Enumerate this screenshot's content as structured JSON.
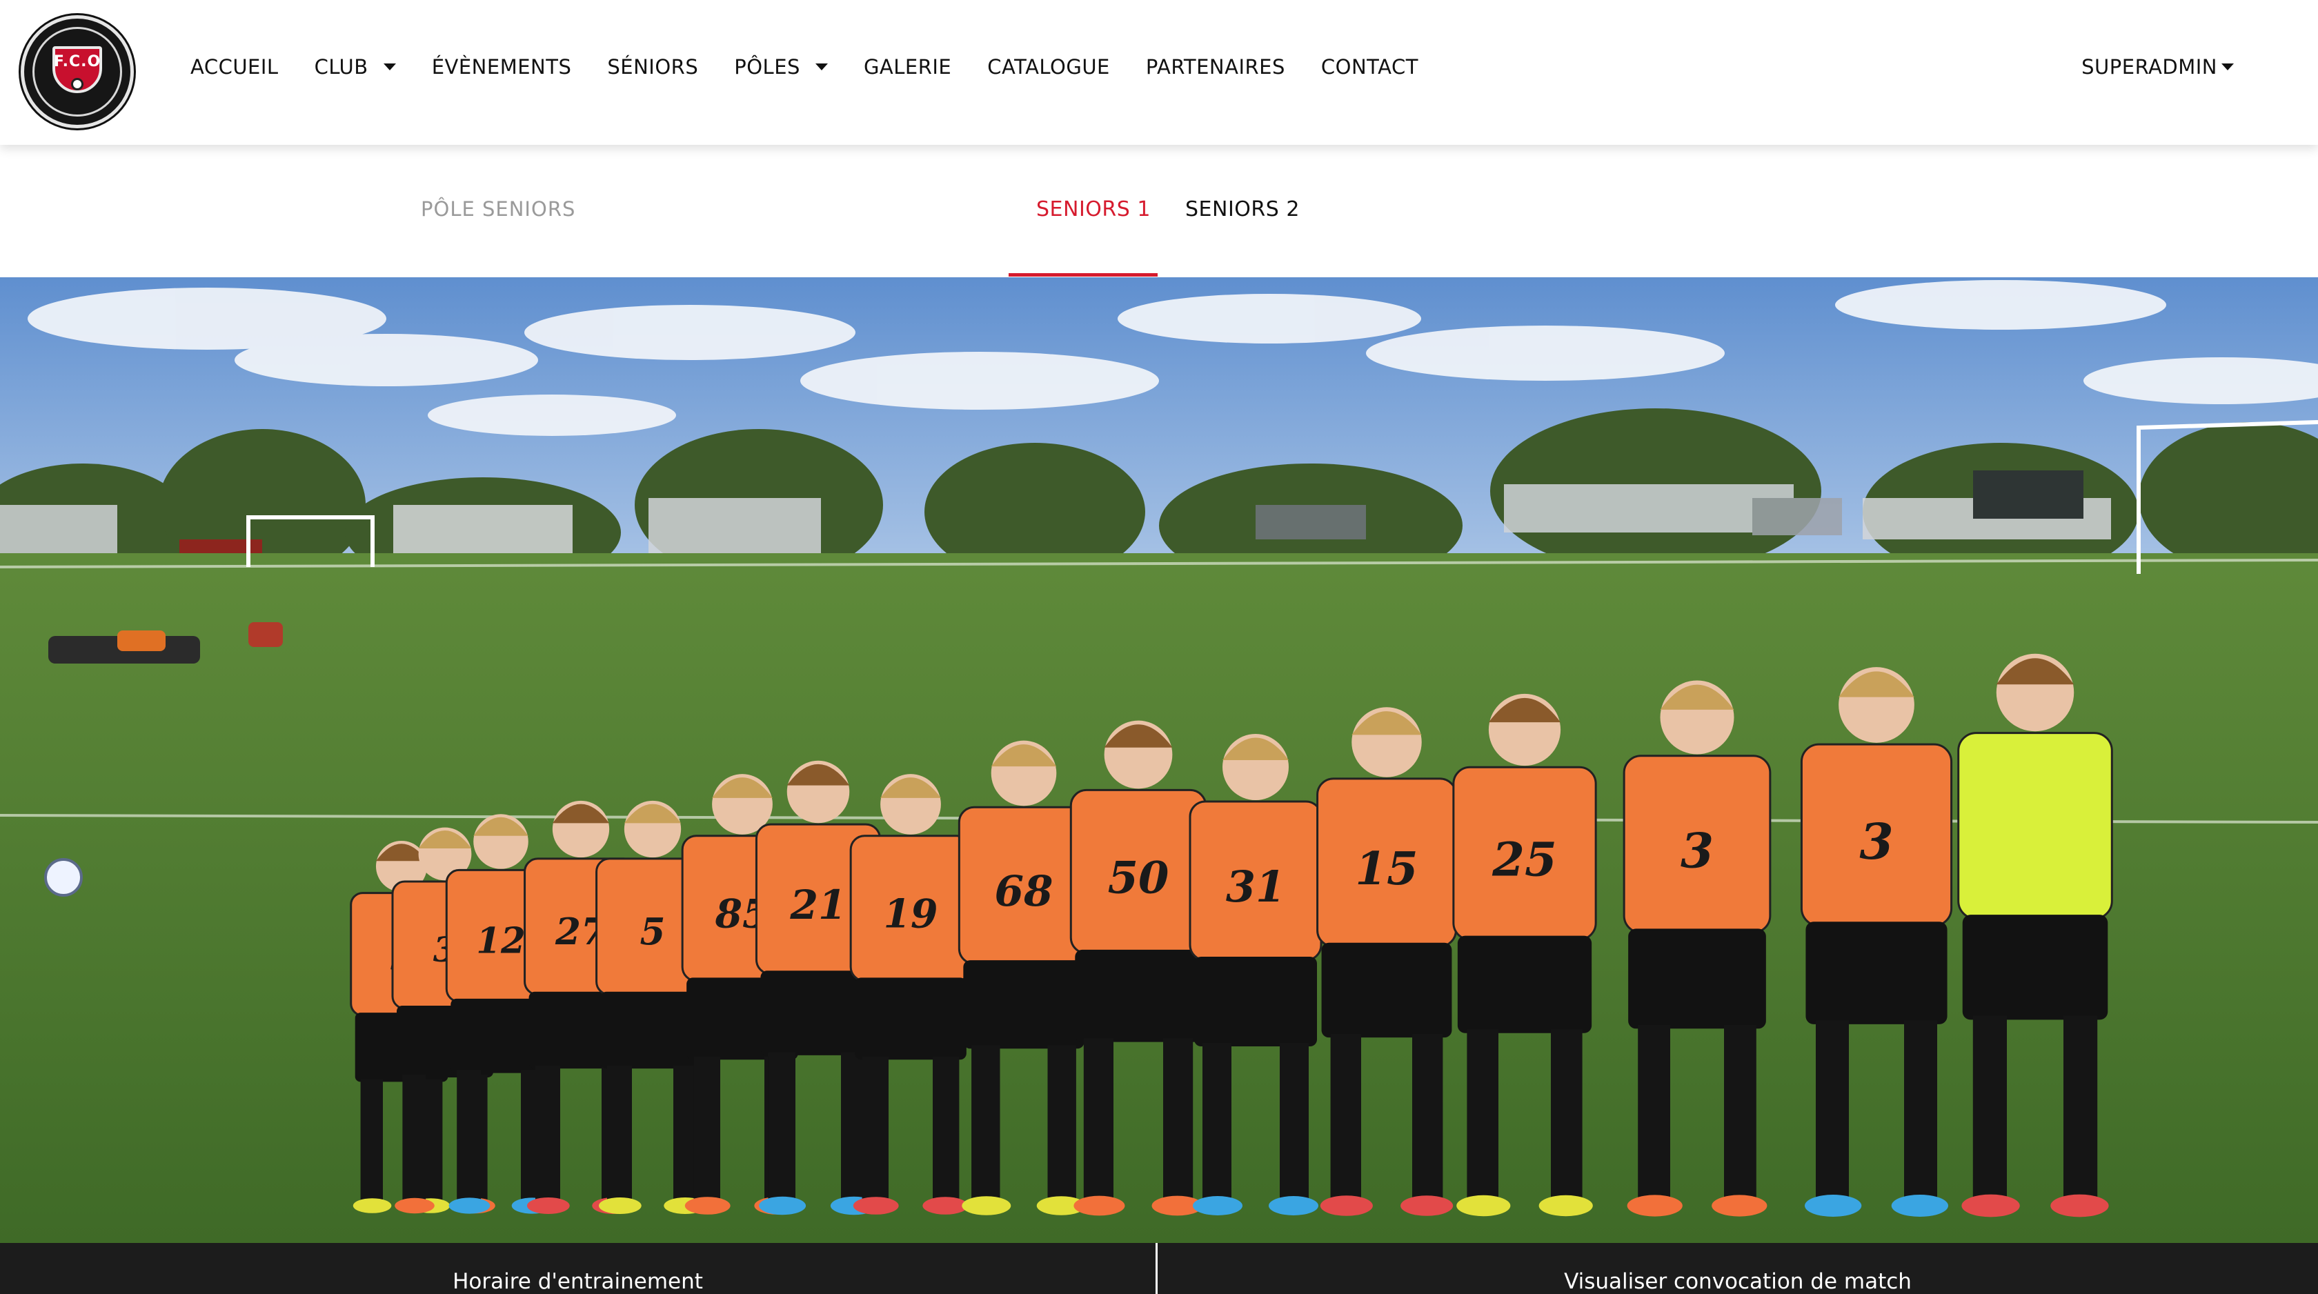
{
  "brand": {
    "logo_text": "F.C.O",
    "logo_icon": "club-crest-icon"
  },
  "nav": {
    "items": [
      {
        "label": "ACCUEIL",
        "dropdown": false
      },
      {
        "label": "CLUB",
        "dropdown": true
      },
      {
        "label": "ÉVÈNEMENTS",
        "dropdown": false
      },
      {
        "label": "SÉNIORS",
        "dropdown": false
      },
      {
        "label": "PÔLES",
        "dropdown": true
      },
      {
        "label": "GALERIE",
        "dropdown": false
      },
      {
        "label": "CATALOGUE",
        "dropdown": false
      },
      {
        "label": "PARTENAIRES",
        "dropdown": false
      },
      {
        "label": "CONTACT",
        "dropdown": false
      }
    ],
    "user_label": "SUPERADMIN"
  },
  "subnav": {
    "title": "PÔLE SENIORS",
    "tabs": [
      {
        "label": "SENIORS 1",
        "active": true
      },
      {
        "label": "SENIORS 2",
        "active": false
      }
    ]
  },
  "hero": {
    "jersey_numbers": [
      "5",
      "3",
      "12",
      "27",
      "5",
      "85",
      "21",
      "19",
      "68",
      "50",
      "31",
      "15",
      "25",
      "3",
      "3",
      ""
    ]
  },
  "actions": {
    "training_schedule": "Horaire d'entrainement",
    "match_convocation": "Visualiser convocation de match"
  },
  "colors": {
    "accent": "#d61b2e",
    "jersey": "#f07a3a",
    "bottom_bar": "#1c1c1c"
  }
}
